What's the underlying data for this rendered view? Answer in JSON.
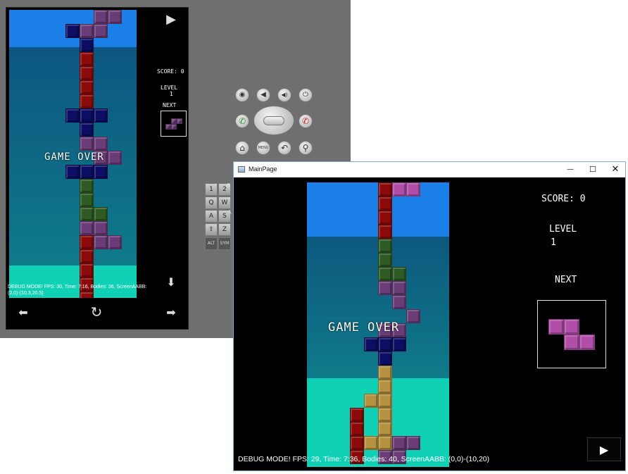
{
  "emulator": {
    "phone_game": {
      "game_over": "GAME OVER",
      "score": "SCORE: 0",
      "level_label": "LEVEL",
      "level_value": "1",
      "next_label": "NEXT",
      "debug_line1": "DEBUG MODE! FPS: 30, Time: 7:16, Bodies: 36, ScreenAABB:",
      "debug_line2": "(0,0)-(10.3,20.5)",
      "play_icon": "▶",
      "down_icon": "⬇",
      "left_icon": "⬅",
      "rotate_icon": "↻",
      "right_icon": "➡"
    },
    "controls": {
      "camera": "◉",
      "vol_down": "◀",
      "vol_up": "◀)",
      "power": "⏻",
      "call": "✆",
      "end_call": "✆",
      "home": "⌂",
      "menu": "MENU",
      "back": "↶",
      "search": "⚲"
    },
    "keyboard": [
      "1",
      "2",
      "Q",
      "W",
      "A",
      "S",
      "⇧",
      "Z",
      "ALT",
      "SYM"
    ],
    "keyboard_extra": [
      "@",
      "~",
      "\\"
    ]
  },
  "window": {
    "title": "MainPage",
    "minimize": "—",
    "maximize": "☐",
    "close": "✕",
    "game_over": "GAME OVER",
    "score": "SCORE: 0",
    "level_label": "LEVEL",
    "level_value": "1",
    "next_label": "NEXT",
    "debug": "DEBUG MODE! FPS: 29, Time: 7:36, Bodies: 40, ScreenAABB: (0,0)-(10,20)",
    "play_icon": "▶"
  },
  "colors": {
    "sky": "#1a7fe6",
    "deep": "#0d5a7d",
    "cyan": "#0ecdb8",
    "red": "#8b0a0a",
    "purple": "#6a3d78",
    "magenta": "#b14ea8",
    "navy": "#0b0e62",
    "green": "#2e5a24",
    "tan": "#b5923f"
  }
}
